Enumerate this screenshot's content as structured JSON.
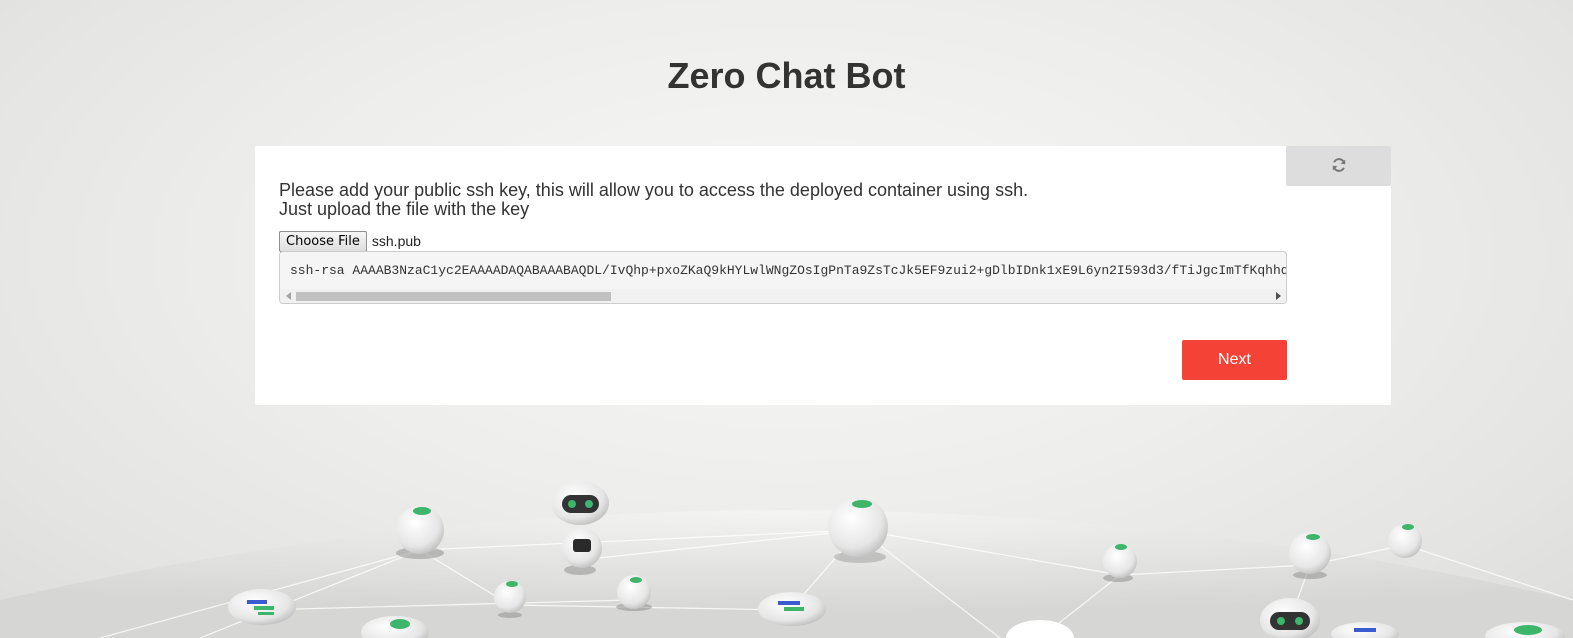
{
  "page": {
    "title": "Zero Chat Bot"
  },
  "card": {
    "instruction_line1": "Please add your public ssh key, this will allow you to access the deployed container using ssh.",
    "instruction_line2": "Just upload the file with the key",
    "file_input": {
      "button_label": "Choose File",
      "selected_file": "ssh.pub"
    },
    "ssh_key_value": "ssh-rsa AAAAB3NzaC1yc2EAAAADAQABAAABAQDL/IvQhp+pxoZKaQ9kHYLwlWNgZOsIgPnTa9ZsTcJk5EF9zui2+gDlbIDnk1xE9L6yn2I593d3/fTiJgcImTfKqhhd",
    "refresh_icon": "refresh-icon",
    "next_label": "Next"
  },
  "colors": {
    "accent": "#f44336",
    "title": "#333333",
    "card_background": "#ffffff",
    "page_background": "#eeeeec"
  }
}
